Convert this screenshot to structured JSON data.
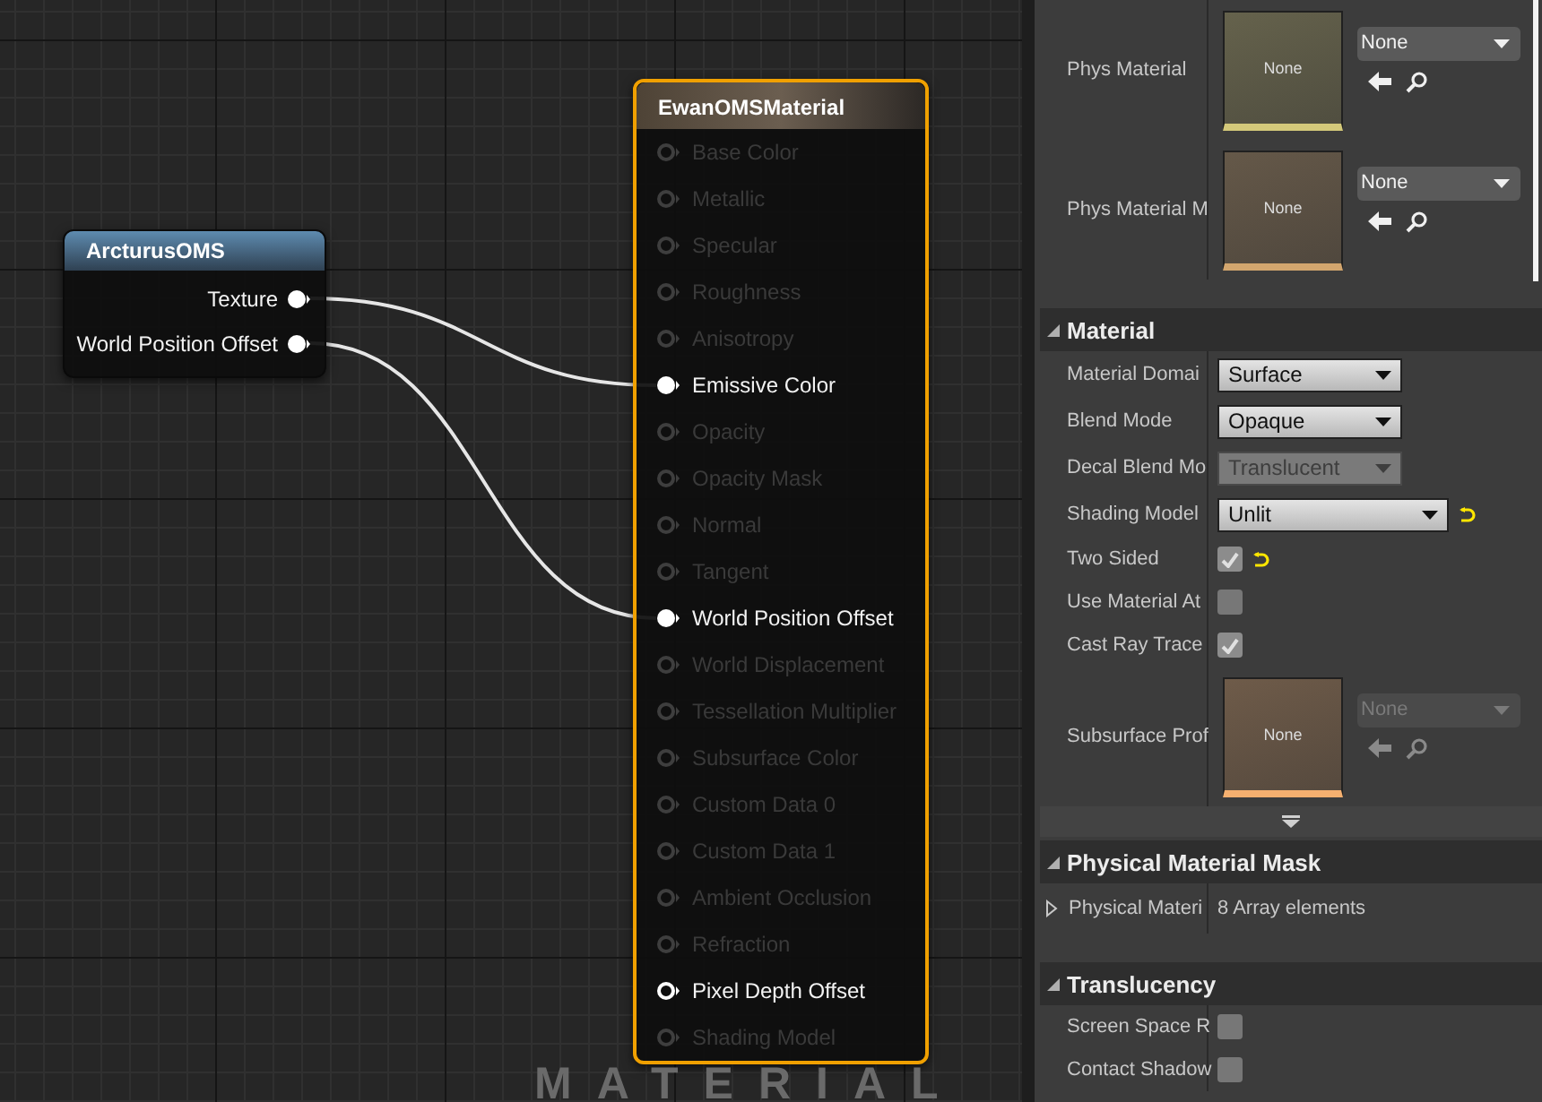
{
  "graph": {
    "label": "MATERIAL",
    "function_node": {
      "title": "ArcturusOMS",
      "outputs": [
        {
          "label": "Texture",
          "connected": true
        },
        {
          "label": "World Position Offset",
          "connected": true
        }
      ]
    },
    "material_node": {
      "title": "EwanOMSMaterial",
      "selected": true,
      "inputs": [
        {
          "label": "Base Color",
          "enabled": false,
          "connected": false
        },
        {
          "label": "Metallic",
          "enabled": false,
          "connected": false
        },
        {
          "label": "Specular",
          "enabled": false,
          "connected": false
        },
        {
          "label": "Roughness",
          "enabled": false,
          "connected": false
        },
        {
          "label": "Anisotropy",
          "enabled": false,
          "connected": false
        },
        {
          "label": "Emissive Color",
          "enabled": true,
          "connected": true
        },
        {
          "label": "Opacity",
          "enabled": false,
          "connected": false
        },
        {
          "label": "Opacity Mask",
          "enabled": false,
          "connected": false
        },
        {
          "label": "Normal",
          "enabled": false,
          "connected": false
        },
        {
          "label": "Tangent",
          "enabled": false,
          "connected": false
        },
        {
          "label": "World Position Offset",
          "enabled": true,
          "connected": true
        },
        {
          "label": "World Displacement",
          "enabled": false,
          "connected": false
        },
        {
          "label": "Tessellation Multiplier",
          "enabled": false,
          "connected": false
        },
        {
          "label": "Subsurface Color",
          "enabled": false,
          "connected": false
        },
        {
          "label": "Custom Data 0",
          "enabled": false,
          "connected": false
        },
        {
          "label": "Custom Data 1",
          "enabled": false,
          "connected": false
        },
        {
          "label": "Ambient Occlusion",
          "enabled": false,
          "connected": false
        },
        {
          "label": "Refraction",
          "enabled": false,
          "connected": false
        },
        {
          "label": "Pixel Depth Offset",
          "enabled": true,
          "connected": false
        },
        {
          "label": "Shading Model",
          "enabled": false,
          "connected": false
        }
      ]
    }
  },
  "details": {
    "sections": [
      {
        "rows": [
          {
            "kind": "asset",
            "label": "Phys Material",
            "thumbnail": "None",
            "value": "None",
            "color": "#d4c97a",
            "disabled": false
          },
          {
            "kind": "asset",
            "label": "Phys Material M",
            "thumbnail": "None",
            "value": "None",
            "color": "#d3a66e",
            "disabled": false
          }
        ]
      },
      {
        "title": "Material",
        "expanded": true,
        "more": true,
        "rows": [
          {
            "kind": "dropdown",
            "label": "Material Domai",
            "value": "Surface",
            "disabled": false,
            "wide": false,
            "reset": false
          },
          {
            "kind": "dropdown",
            "label": "Blend Mode",
            "value": "Opaque",
            "disabled": false,
            "wide": false,
            "reset": false
          },
          {
            "kind": "dropdown",
            "label": "Decal Blend Mo",
            "value": "Translucent",
            "disabled": true,
            "wide": false,
            "reset": false
          },
          {
            "kind": "dropdown",
            "label": "Shading Model",
            "value": "Unlit",
            "disabled": false,
            "wide": true,
            "reset": true
          },
          {
            "kind": "checkbox",
            "label": "Two Sided",
            "checked": true,
            "reset": true
          },
          {
            "kind": "checkbox",
            "label": "Use Material At",
            "checked": false,
            "reset": false
          },
          {
            "kind": "checkbox",
            "label": "Cast Ray Trace",
            "checked": true,
            "reset": false
          },
          {
            "kind": "asset",
            "label": "Subsurface Prof",
            "thumbnail": "None",
            "value": "None",
            "color": "#f5b070",
            "disabled": true
          }
        ]
      },
      {
        "title": "Physical Material Mask",
        "expanded": true,
        "more": false,
        "rows": [
          {
            "kind": "array",
            "label": "Physical Materi",
            "value": "8 Array elements",
            "expanded": false
          }
        ]
      },
      {
        "title": "Translucency",
        "expanded": true,
        "more": false,
        "rows": [
          {
            "kind": "checkbox",
            "label": "Screen Space R",
            "checked": false,
            "reset": false
          },
          {
            "kind": "checkbox",
            "label": "Contact Shadow",
            "checked": false,
            "reset": false
          }
        ]
      }
    ]
  }
}
